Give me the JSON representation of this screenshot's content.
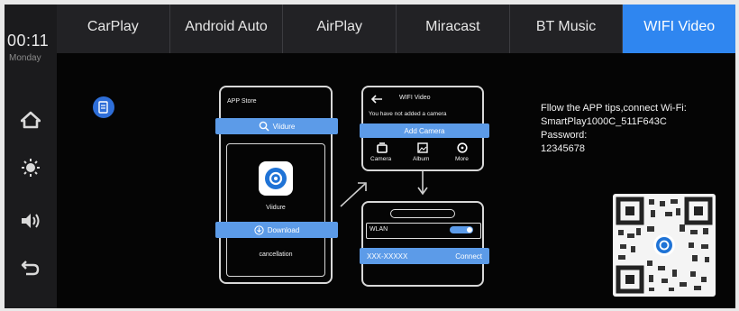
{
  "status": {
    "time": "00:11",
    "day": "Monday"
  },
  "rail": {
    "buttons": [
      "home-icon",
      "brightness-icon",
      "volume-icon",
      "back-icon"
    ]
  },
  "tabs": [
    {
      "label": "CarPlay",
      "active": false
    },
    {
      "label": "Android Auto",
      "active": false
    },
    {
      "label": "AirPlay",
      "active": false
    },
    {
      "label": "Miracast",
      "active": false
    },
    {
      "label": "BT Music",
      "active": false
    },
    {
      "label": "WIFI Video",
      "active": true
    }
  ],
  "colors": {
    "accent": "#2f86f0",
    "guide_bar": "#5c9be8"
  },
  "guide": {
    "store_title": "APP Store",
    "search_label": "Viidure",
    "app_name": "Viidure",
    "download_label": "Download",
    "cancel_label": "cancellation",
    "wifi_title": "WIFI Video",
    "no_camera_text": "You have not added a camera",
    "add_camera_label": "Add Camera",
    "nav_camera": "Camera",
    "nav_album": "Album",
    "nav_more": "More",
    "wlan_label": "WLAN",
    "ssid_label": "XXX-XXXXX",
    "connect_label": "Connect"
  },
  "instructions": {
    "line1": "Fllow the APP tips,connect Wi-Fi:",
    "line2": "SmartPlay1000C_511F643C",
    "line3": "Password:",
    "line4": "12345678"
  }
}
